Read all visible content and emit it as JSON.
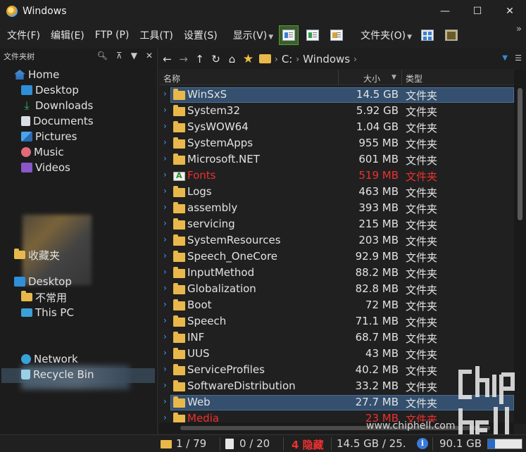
{
  "window": {
    "title": "Windows"
  },
  "menu": {
    "items": [
      "文件(F)",
      "编辑(E)",
      "FTP (P)",
      "工具(T)",
      "设置(S)",
      "显示(V)",
      "文件夹(O)"
    ],
    "overflow": "»"
  },
  "left_pane": {
    "header": "文件夹树",
    "tree": [
      {
        "label": "Home",
        "icon": "home-icon"
      },
      {
        "label": "Desktop",
        "icon": "desktop-icon"
      },
      {
        "label": "Downloads",
        "icon": "downloads-icon"
      },
      {
        "label": "Documents",
        "icon": "documents-icon"
      },
      {
        "label": "Pictures",
        "icon": "pictures-icon"
      },
      {
        "label": "Music",
        "icon": "music-icon"
      },
      {
        "label": "Videos",
        "icon": "videos-icon"
      },
      {
        "label": "收藏夹",
        "icon": "folder-icon"
      },
      {
        "label": "Desktop",
        "icon": "desktop-icon"
      },
      {
        "label": "不常用",
        "icon": "folder-icon"
      },
      {
        "label": "This PC",
        "icon": "pc-icon"
      },
      {
        "label": "Network",
        "icon": "network-icon"
      },
      {
        "label": "Recycle Bin",
        "icon": "recycle-bin-icon"
      }
    ]
  },
  "address": {
    "drive": "C:",
    "folder": "Windows"
  },
  "columns": {
    "name": "名称",
    "size": "大小",
    "type": "类型"
  },
  "files": [
    {
      "name": "WinSxS",
      "size": "14.5 GB",
      "type": "文件夹",
      "selected": true
    },
    {
      "name": "System32",
      "size": "5.92 GB",
      "type": "文件夹"
    },
    {
      "name": "SysWOW64",
      "size": "1.04 GB",
      "type": "文件夹"
    },
    {
      "name": "SystemApps",
      "size": "955 MB",
      "type": "文件夹"
    },
    {
      "name": "Microsoft.NET",
      "size": "601 MB",
      "type": "文件夹"
    },
    {
      "name": "Fonts",
      "size": "519 MB",
      "type": "文件夹",
      "hidden": true,
      "icon": "font-folder-icon"
    },
    {
      "name": "Logs",
      "size": "463 MB",
      "type": "文件夹"
    },
    {
      "name": "assembly",
      "size": "393 MB",
      "type": "文件夹"
    },
    {
      "name": "servicing",
      "size": "215 MB",
      "type": "文件夹"
    },
    {
      "name": "SystemResources",
      "size": "203 MB",
      "type": "文件夹"
    },
    {
      "name": "Speech_OneCore",
      "size": "92.9 MB",
      "type": "文件夹"
    },
    {
      "name": "InputMethod",
      "size": "88.2 MB",
      "type": "文件夹"
    },
    {
      "name": "Globalization",
      "size": "82.8 MB",
      "type": "文件夹"
    },
    {
      "name": "Boot",
      "size": "72 MB",
      "type": "文件夹"
    },
    {
      "name": "Speech",
      "size": "71.1 MB",
      "type": "文件夹"
    },
    {
      "name": "INF",
      "size": "68.7 MB",
      "type": "文件夹"
    },
    {
      "name": "UUS",
      "size": "43 MB",
      "type": "文件夹"
    },
    {
      "name": "ServiceProfiles",
      "size": "40.2 MB",
      "type": "文件夹"
    },
    {
      "name": "SoftwareDistribution",
      "size": "33.2 MB",
      "type": "文件夹"
    },
    {
      "name": "Web",
      "size": "27.7 MB",
      "type": "文件夹",
      "selected": true
    },
    {
      "name": "Media",
      "size": "23 MB",
      "type": "文件夹",
      "hidden": true
    }
  ],
  "status": {
    "folders": "1 / 79",
    "files": "0 / 20",
    "hidden": "4 隐藏",
    "size": "14.5 GB / 25.",
    "free": "90.1 GB",
    "disk_used_fraction": 0.2
  },
  "watermark": {
    "url": "www.chiphell.com",
    "logo": "chip hell"
  }
}
